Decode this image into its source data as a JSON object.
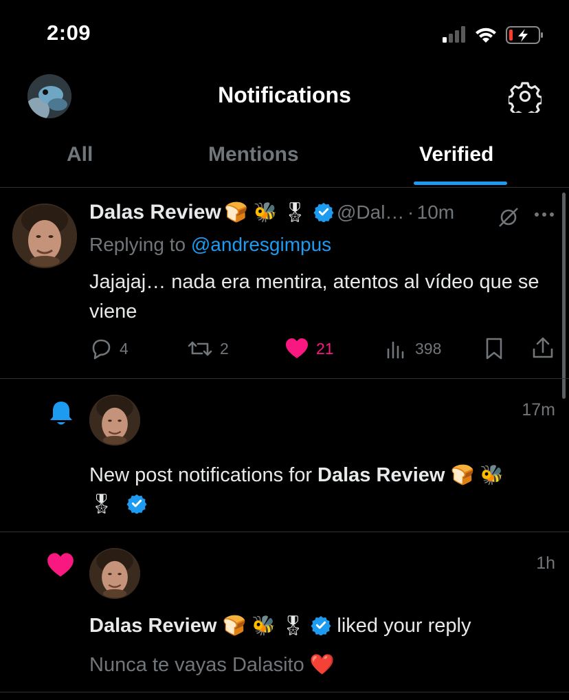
{
  "status_bar": {
    "time": "2:09"
  },
  "header": {
    "title": "Notifications"
  },
  "tabs": [
    {
      "label": "All"
    },
    {
      "label": "Mentions"
    },
    {
      "label": "Verified"
    }
  ],
  "reply_post": {
    "name": "Dalas Review",
    "emojis": "🍞 🐝 🎖",
    "handle": "@Dal…",
    "dot": "·",
    "time": "10m",
    "replying_prefix": "Replying to",
    "replying_handle": "@andresgimpus",
    "text": "Jajajaj… nada era mentira, atentos al vídeo que se viene",
    "replies": "4",
    "reposts": "2",
    "likes": "21",
    "views": "398"
  },
  "notif_new_post": {
    "time": "17m",
    "text_prefix": "New post notifications for",
    "name": "Dalas Review",
    "emojis_line1": "🍞 🐝",
    "emojis_line2": "🎖"
  },
  "notif_like": {
    "time": "1h",
    "name": "Dalas Review",
    "emojis": "🍞 🐝 🎖",
    "action_text": "liked your reply",
    "quoted": "Nunca te vayas Dalasito",
    "quoted_emoji": "❤️"
  },
  "colors": {
    "accent": "#1d9bf0",
    "like": "#f91880",
    "muted": "#71767b",
    "background": "#000000"
  }
}
